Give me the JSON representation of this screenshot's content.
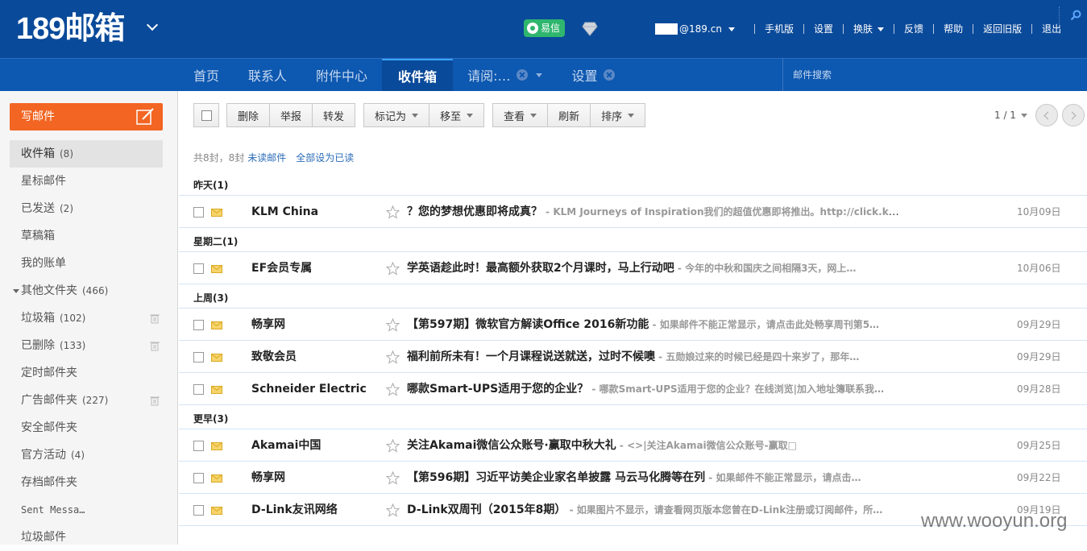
{
  "header": {
    "logo": "189邮箱",
    "yixin": "易信",
    "user_domain": "@189.cn",
    "links": [
      "手机版",
      "设置",
      "换肤",
      "反馈",
      "帮助",
      "返回旧版",
      "退出"
    ]
  },
  "nav": {
    "tabs": [
      "首页",
      "联系人",
      "附件中心",
      "收件箱",
      "请阅:…",
      "设置"
    ],
    "search_placeholder": "邮件搜索"
  },
  "sidebar": {
    "compose": "写邮件",
    "folders": [
      {
        "name": "收件箱",
        "count": "(8)"
      },
      {
        "name": "星标邮件",
        "count": ""
      },
      {
        "name": "已发送",
        "count": "(2)"
      },
      {
        "name": "草稿箱",
        "count": ""
      },
      {
        "name": "我的账单",
        "count": ""
      },
      {
        "name": "其他文件夹",
        "count": "(466)"
      },
      {
        "name": "垃圾箱",
        "count": "(102)"
      },
      {
        "name": "已删除",
        "count": "(133)"
      },
      {
        "name": "定时邮件夹",
        "count": ""
      },
      {
        "name": "广告邮件夹",
        "count": "(227)"
      },
      {
        "name": "安全邮件夹",
        "count": ""
      },
      {
        "name": "官方活动",
        "count": "(4)"
      },
      {
        "name": "存档邮件夹",
        "count": ""
      },
      {
        "name": "Sent Messa…",
        "count": ""
      },
      {
        "name": "垃圾邮件",
        "count": ""
      }
    ]
  },
  "toolbar": {
    "delete": "删除",
    "report": "举报",
    "forward": "转发",
    "mark_as": "标记为",
    "move_to": "移至",
    "view": "查看",
    "refresh": "刷新",
    "sort": "排序",
    "pager": "1 / 1"
  },
  "summary": {
    "total": "共8封，8封",
    "unread": "未读邮件",
    "mark_all_read": "全部设为已读"
  },
  "groups": [
    {
      "label": "昨天(1)",
      "mails": [
        {
          "sender": "KLM China",
          "subject": "？您的梦想优惠即将成真？",
          "preview": " - KLM Journeys of Inspiration我们的超值优惠即将推出。http://click.klm-…",
          "date": "10月09日"
        }
      ]
    },
    {
      "label": "星期二(1)",
      "mails": [
        {
          "sender": "EF会员专属",
          "subject": "学英语趁此时！最高额外获取2个月课时，马上行动吧",
          "preview": " - 今年的中秋和国庆之间相隔3天，网上…",
          "date": "10月06日"
        }
      ]
    },
    {
      "label": "上周(3)",
      "mails": [
        {
          "sender": "畅享网",
          "subject": "【第597期】微软官方解读Office 2016新功能",
          "preview": " - 如果邮件不能正常显示，请点击此处畅享周刊第5…",
          "date": "09月29日"
        },
        {
          "sender": "致敬会员",
          "subject": "福利前所未有！一个月课程说送就送，过时不候噢",
          "preview": " - 五勋娘过来的时候已经是四十来岁了，那年…",
          "date": "09月29日"
        },
        {
          "sender": "Schneider Electric",
          "subject": "哪款Smart-UPS适用于您的企业？",
          "preview": " - 哪款Smart-UPS适用于您的企业？在线浏览|加入地址簿联系我…",
          "date": "09月28日"
        }
      ]
    },
    {
      "label": "更早(3)",
      "mails": [
        {
          "sender": "Akamai中国",
          "subject": "关注Akamai微信公众账号·赢取中秋大礼",
          "preview": " - <>|关注Akamai微信公众账号-赢取□",
          "date": "09月25日"
        },
        {
          "sender": "畅享网",
          "subject": "【第596期】习近平访美企业家名单披露 马云马化腾等在列",
          "preview": " - 如果邮件不能正常显示，请点击…",
          "date": "09月22日"
        },
        {
          "sender": "D-Link友讯网络",
          "subject": "D-Link双周刊（2015年8期）",
          "preview": " - 如果图片不显示，请查看网页版本您曾在D-Link注册或订阅邮件，所…",
          "date": "09月19日"
        }
      ]
    }
  ],
  "watermark": "www.wooyun.org",
  "colors": {
    "header": "#0a4a9a",
    "nav": "#0d58b0",
    "compose": "#f26522",
    "link": "#2b6cb8"
  }
}
